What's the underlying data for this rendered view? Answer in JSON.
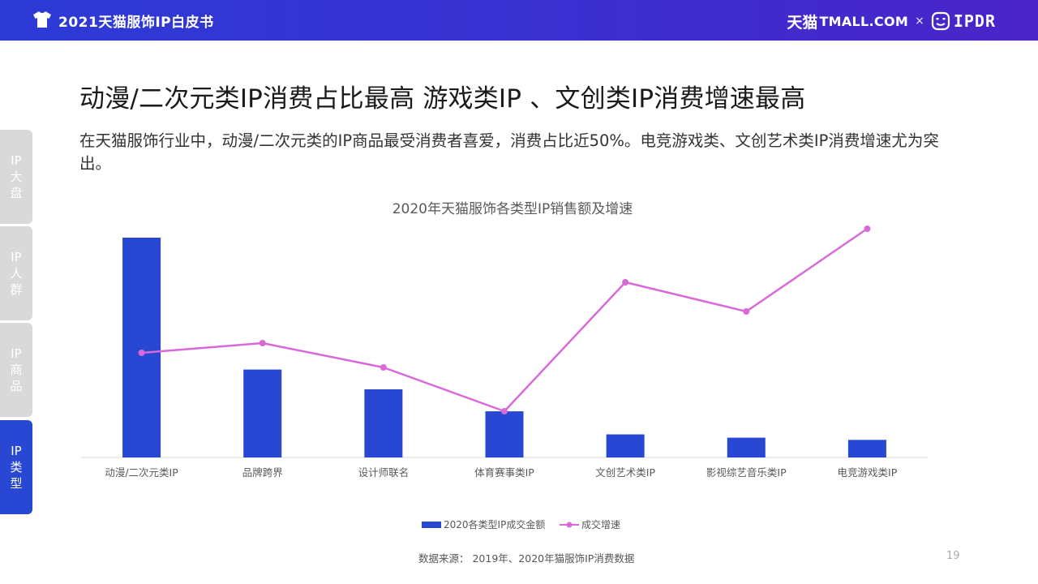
{
  "header": {
    "title": "2021天猫服饰IP白皮书",
    "brand_tmall_cn": "天猫",
    "brand_tmall_en": "TMALL.COM",
    "brand_separator": "×",
    "brand_partner": "IPDR",
    "icons": [
      "tshirt-icon",
      "ip-face-logo-icon"
    ],
    "bar_color": "#3535d4"
  },
  "side_tabs": [
    {
      "label_lines": [
        "IP",
        "大",
        "盘"
      ],
      "active": false
    },
    {
      "label_lines": [
        "IP",
        "人",
        "群"
      ],
      "active": false
    },
    {
      "label_lines": [
        "IP",
        "商",
        "品"
      ],
      "active": false
    },
    {
      "label_lines": [
        "IP",
        "类",
        "型"
      ],
      "active": true
    }
  ],
  "headline": "动漫/二次元类IP消费占比最高  游戏类IP 、文创类IP消费增速最高",
  "intro": "在天猫服饰行业中，动漫/二次元类的IP商品最受消费者喜爱，消费占比近50%。电竞游戏类、文创艺术类IP消费增速尤为突出。",
  "chart_data": {
    "type": "bar",
    "title": "2020年天猫服饰各类型IP销售额及增速",
    "categories": [
      "动漫/二次元类IP",
      "品牌跨界",
      "设计师联名",
      "体育赛事类IP",
      "文创艺术类IP",
      "影视综艺音乐类IP",
      "电竞游戏类IP"
    ],
    "series": [
      {
        "name": "2020各类型IP成交金额",
        "type": "bar",
        "axis": "left",
        "color": "#2847d3",
        "values": [
          100,
          40,
          31,
          21,
          10.5,
          9,
          8
        ]
      },
      {
        "name": "成交增速",
        "type": "line",
        "axis": "right",
        "color": "#d86ad8",
        "values": [
          43,
          47,
          37,
          19,
          72,
          60,
          94
        ]
      }
    ],
    "left_axis_range": [
      0,
      100
    ],
    "right_axis_range": [
      0,
      100
    ],
    "axes_labels_visible": false,
    "grid": false,
    "legend_position": "bottom-center"
  },
  "footer": {
    "source": "数据来源：  2019年、2020年猫服饰IP消费数据",
    "page": "19"
  }
}
